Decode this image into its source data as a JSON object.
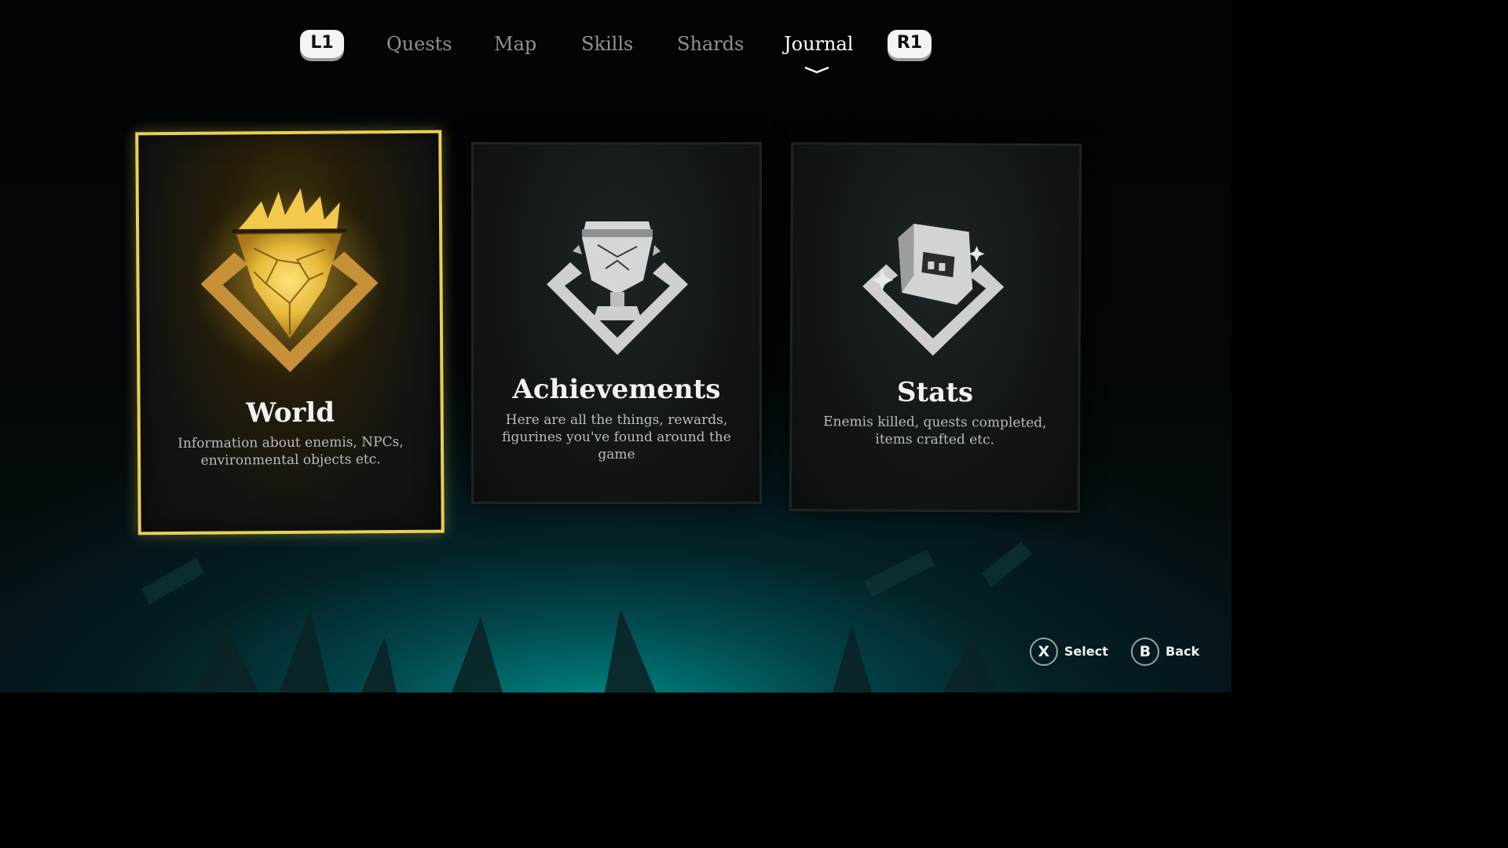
{
  "nav": {
    "left_shoulder": "L1",
    "right_shoulder": "R1",
    "tabs": [
      {
        "label": "Quests",
        "active": false
      },
      {
        "label": "Map",
        "active": false
      },
      {
        "label": "Skills",
        "active": false
      },
      {
        "label": "Shards",
        "active": false
      },
      {
        "label": "Journal",
        "active": true
      }
    ]
  },
  "cards": [
    {
      "title": "World",
      "description": "Information about enemis, NPCs, environmental objects etc.",
      "icon": "crown-diamond-icon",
      "selected": true
    },
    {
      "title": "Achievements",
      "description": "Here are all the things, rewards, figurines you've found around the game",
      "icon": "trophy-icon",
      "selected": false
    },
    {
      "title": "Stats",
      "description": "Enemis killed, quests completed, items crafted etc.",
      "icon": "stats-book-icon",
      "selected": false
    }
  ],
  "prompts": [
    {
      "button": "X",
      "label": "Select"
    },
    {
      "button": "B",
      "label": "Back"
    }
  ],
  "colors": {
    "selection_gold": "#e9cf55",
    "ambient_teal": "#009691",
    "inactive_tab": "#8c9395"
  }
}
